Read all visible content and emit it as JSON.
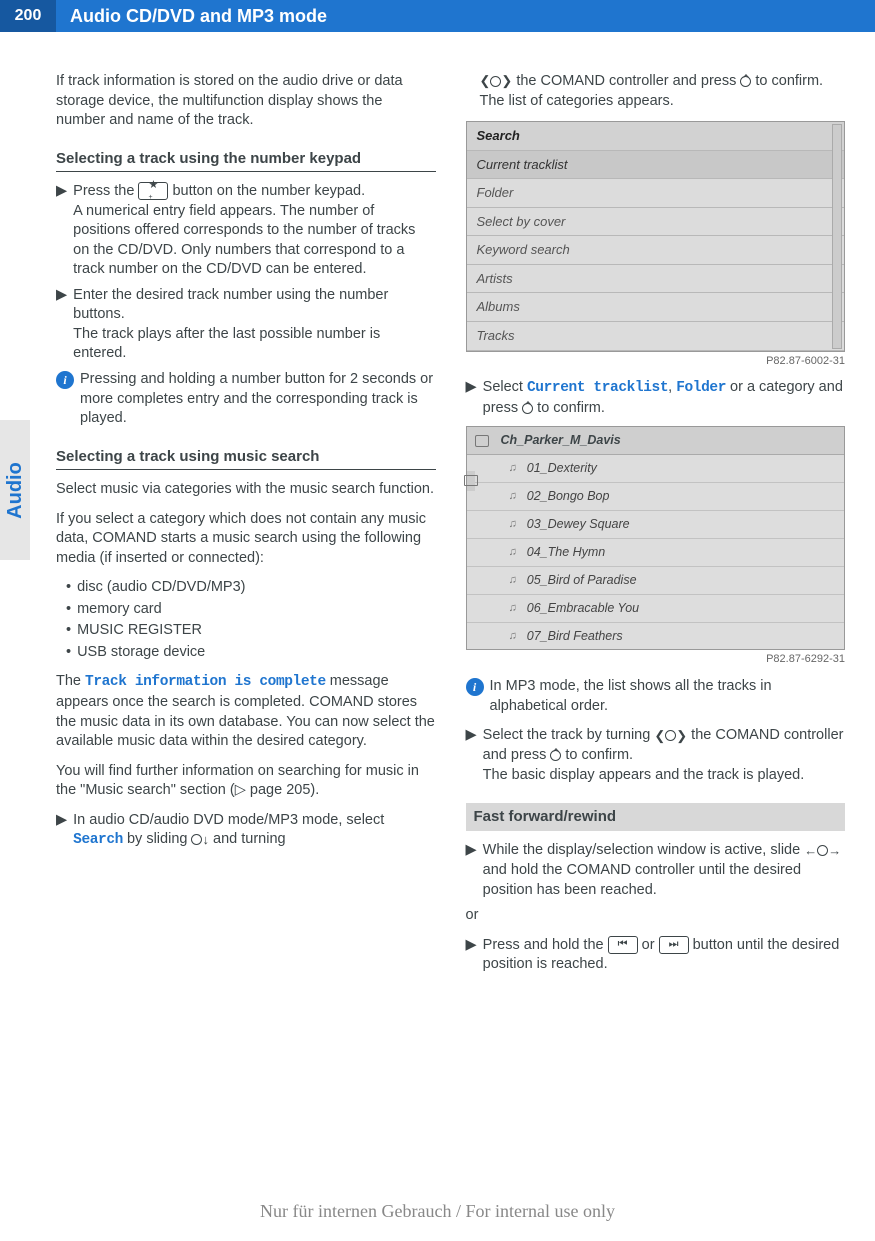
{
  "page_number": "200",
  "page_title": "Audio CD/DVD and MP3 mode",
  "side_tab": "Audio",
  "col1": {
    "intro": "If track information is stored on the audio drive or data storage device, the multifunction display shows the number and name of the track.",
    "sub1": "Selecting a track using the number keypad",
    "step1a": "Press the ",
    "key_star": "★",
    "step1b": " button on the number keypad.",
    "step1_detail": "A numerical entry field appears. The number of positions offered corresponds to the number of tracks on the CD/DVD. Only numbers that correspond to a track number on the CD/DVD can be entered.",
    "step2a": "Enter the desired track number using the number buttons.",
    "step2_detail": "The track plays after the last possible number is entered.",
    "info1": "Pressing and holding a number button for 2 seconds or more completes entry and the corresponding track is played.",
    "sub2": "Selecting a track using music search",
    "p1": "Select music via categories with the music search function.",
    "p2": "If you select a category which does not contain any music data, COMAND starts a music search using the following media (if inserted or connected):",
    "bullets": [
      "disc (audio CD/DVD/MP3)",
      "memory card",
      "MUSIC REGISTER",
      "USB storage device"
    ],
    "p3a": "The ",
    "p3_code": "Track information is complete",
    "p3b": " message appears once the search is completed. COMAND stores the music data in its own database. You can now select the available music data within the desired category.",
    "p4": "You will find further information on searching for music in the \"Music search\" section (▷ page 205).",
    "step3a": "In audio CD/audio DVD mode/MP3 mode, select ",
    "step3_code": "Search",
    "step3b": " by sliding ",
    "step3c": " and turning"
  },
  "col2": {
    "step_cont_a": "the COMAND controller and press ",
    "step_cont_b": " to confirm.",
    "step_cont_detail": "The list of categories appears.",
    "screenshot1": {
      "rows": [
        "Search",
        "Current tracklist",
        "Folder",
        "Select by cover",
        "Keyword search",
        "Artists",
        "Albums",
        "Tracks"
      ],
      "caption": "P82.87-6002-31"
    },
    "step4a": "Select ",
    "step4_code1": "Current tracklist",
    "step4_mid": ", ",
    "step4_code2": "Folder",
    "step4b": " or a category and press ",
    "step4c": " to confirm.",
    "screenshot2": {
      "title": "Ch_Parker_M_Davis",
      "tracks": [
        "01_Dexterity",
        "02_Bongo Bop",
        "03_Dewey Square",
        "04_The Hymn",
        "05_Bird of Paradise",
        "06_Embracable You",
        "07_Bird Feathers"
      ],
      "caption": "P82.87-6292-31"
    },
    "info2": "In MP3 mode, the list shows all the tracks in alphabetical order.",
    "step5a": "Select the track by turning ",
    "step5b": " the COMAND controller and press ",
    "step5c": " to confirm.",
    "step5_detail": "The basic display appears and the track is played.",
    "sec_head": "Fast forward/rewind",
    "ff_step1a": "While the display/selection window is active, slide ",
    "ff_step1b": " and hold the COMAND controller until the desired position has been reached.",
    "or": "or",
    "ff_step2a": "Press and hold the ",
    "ff_key1": "⏮",
    "ff_or": " or ",
    "ff_key2": "⏭",
    "ff_step2b": " button until the desired position is reached."
  },
  "footer": "Nur für internen Gebrauch / For internal use only"
}
